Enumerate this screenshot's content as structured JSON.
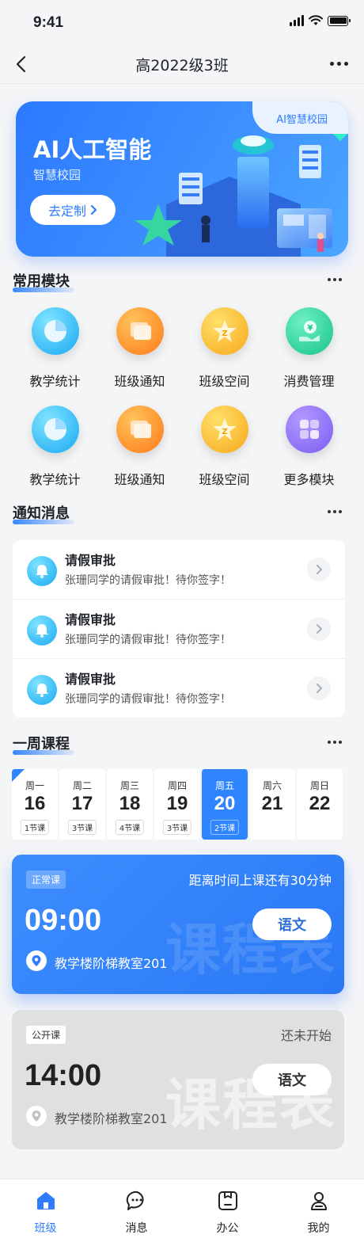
{
  "status_bar": {
    "time": "9:41"
  },
  "nav": {
    "title": "高2022级3班"
  },
  "banner": {
    "tag": "AI智慧校园",
    "title": "AI人工智能",
    "subtitle": "智慧校园",
    "button_label": "去定制"
  },
  "modules_section": {
    "title": "常用模块",
    "items": [
      {
        "label": "教学统计",
        "icon": "pie-chart-icon",
        "color": "#19a9f2"
      },
      {
        "label": "班级通知",
        "icon": "message-icon",
        "color": "#ff7a1a"
      },
      {
        "label": "班级空间",
        "icon": "star-icon",
        "color": "#f7a81c"
      },
      {
        "label": "消费管理",
        "icon": "money-hand-icon",
        "color": "#16c38b"
      },
      {
        "label": "教学统计",
        "icon": "pie-chart-icon",
        "color": "#19a9f2"
      },
      {
        "label": "班级通知",
        "icon": "message-icon",
        "color": "#ff7a1a"
      },
      {
        "label": "班级空间",
        "icon": "star-icon",
        "color": "#f7a81c"
      },
      {
        "label": "更多模块",
        "icon": "grid-icon",
        "color": "#7a5cf2"
      }
    ]
  },
  "notice_section": {
    "title": "通知消息",
    "items": [
      {
        "title": "请假审批",
        "desc": "张珊同学的请假审批！待你签字！"
      },
      {
        "title": "请假审批",
        "desc": "张珊同学的请假审批！待你签字！"
      },
      {
        "title": "请假审批",
        "desc": "张珊同学的请假审批！待你签字！"
      }
    ]
  },
  "week_section": {
    "title": "一周课程",
    "days": [
      {
        "name": "周一",
        "num": "16",
        "count": "1节课",
        "active": false
      },
      {
        "name": "周二",
        "num": "17",
        "count": "3节课",
        "active": false
      },
      {
        "name": "周三",
        "num": "18",
        "count": "4节课",
        "active": false
      },
      {
        "name": "周四",
        "num": "19",
        "count": "3节课",
        "active": false
      },
      {
        "name": "周五",
        "num": "20",
        "count": "2节课",
        "active": true
      },
      {
        "name": "周六",
        "num": "21",
        "count": "",
        "active": false
      },
      {
        "name": "周日",
        "num": "22",
        "count": "",
        "active": false
      }
    ]
  },
  "courses": [
    {
      "tag": "正常课",
      "status": "距离时间上课还有30分钟",
      "time": "09:00",
      "subject": "语文",
      "location": "教学楼阶梯教室201",
      "watermark": "课程表"
    },
    {
      "tag": "公开课",
      "status": "还未开始",
      "time": "14:00",
      "subject": "语文",
      "location": "教学楼阶梯教室201",
      "watermark": "课程表"
    }
  ],
  "tab_bar": {
    "items": [
      {
        "label": "班级",
        "icon": "home-icon",
        "active": true
      },
      {
        "label": "消息",
        "icon": "chat-icon",
        "active": false
      },
      {
        "label": "办公",
        "icon": "briefcase-icon",
        "active": false
      },
      {
        "label": "我的",
        "icon": "user-icon",
        "active": false
      }
    ]
  },
  "colors": {
    "accent": "#2f7cff",
    "background": "#f4f5f7"
  }
}
